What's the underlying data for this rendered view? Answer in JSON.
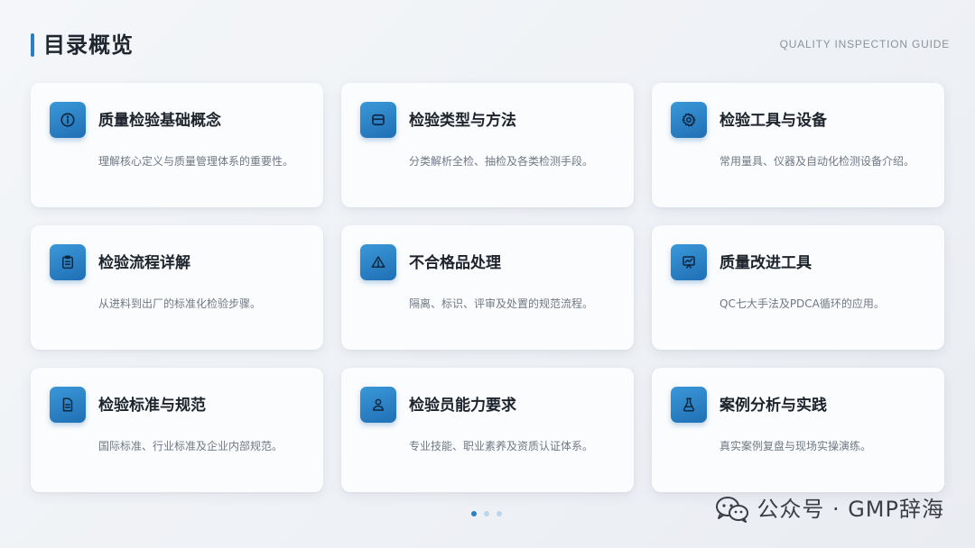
{
  "header": {
    "title": "目录概览",
    "subtitle": "QUALITY INSPECTION GUIDE",
    "accent_color": "#2a7fc4"
  },
  "cards": [
    {
      "title": "质量检验基础概念",
      "desc": "理解核心定义与质量管理体系的重要性。",
      "icon": "info-icon"
    },
    {
      "title": "检验类型与方法",
      "desc": "分类解析全检、抽检及各类检测手段。",
      "icon": "layers-icon"
    },
    {
      "title": "检验工具与设备",
      "desc": "常用量具、仪器及自动化检测设备介绍。",
      "icon": "gear-icon"
    },
    {
      "title": "检验流程详解",
      "desc": "从进料到出厂的标准化检验步骤。",
      "icon": "clipboard-icon"
    },
    {
      "title": "不合格品处理",
      "desc": "隔离、标识、评审及处置的规范流程。",
      "icon": "warning-icon"
    },
    {
      "title": "质量改进工具",
      "desc": "QC七大手法及PDCA循环的应用。",
      "icon": "chart-board-icon"
    },
    {
      "title": "检验标准与规范",
      "desc": "国际标准、行业标准及企业内部规范。",
      "icon": "document-icon"
    },
    {
      "title": "检验员能力要求",
      "desc": "专业技能、职业素养及资质认证体系。",
      "icon": "user-icon"
    },
    {
      "title": "案例分析与实践",
      "desc": "真实案例复盘与现场实操演练。",
      "icon": "flask-icon"
    }
  ],
  "pagination": {
    "active_index": 0,
    "count": 3
  },
  "watermark": {
    "text": "公众号 · GMP辞海",
    "icon": "wechat-icon"
  }
}
